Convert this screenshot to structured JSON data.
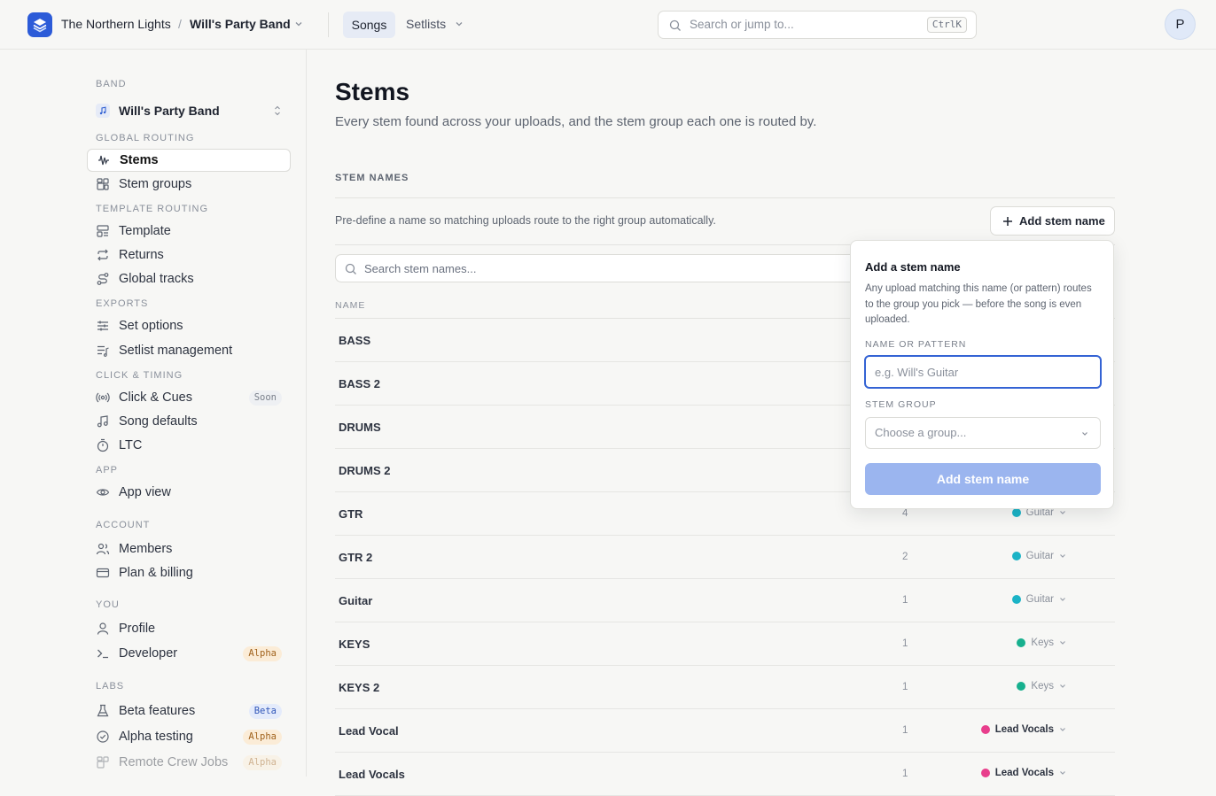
{
  "header": {
    "org_name": "The Northern Lights",
    "separator": "/",
    "band_name": "Will's Party Band",
    "tabs": [
      {
        "label": "Songs"
      },
      {
        "label": "Setlists"
      }
    ],
    "search_placeholder": "Search or jump to...",
    "search_shortcut": "CtrlK",
    "avatar_initial": "P"
  },
  "sidebar": {
    "band_section": "BAND",
    "band_selected": "Will's Party Band",
    "sections": [
      {
        "title": "GLOBAL ROUTING",
        "items": [
          {
            "label": "Stems",
            "icon": "waveform-icon"
          },
          {
            "label": "Stem groups",
            "icon": "grid-icon"
          }
        ]
      },
      {
        "title": "TEMPLATE ROUTING",
        "items": [
          {
            "label": "Template",
            "icon": "layout-icon"
          },
          {
            "label": "Returns",
            "icon": "repeat-icon"
          },
          {
            "label": "Global tracks",
            "icon": "route-icon"
          }
        ]
      },
      {
        "title": "EXPORTS",
        "items": [
          {
            "label": "Set options",
            "icon": "sliders-icon"
          },
          {
            "label": "Setlist management",
            "icon": "list-music-icon"
          }
        ]
      },
      {
        "title": "CLICK & TIMING",
        "items": [
          {
            "label": "Click & Cues",
            "icon": "radio-icon",
            "badge": "Soon"
          },
          {
            "label": "Song defaults",
            "icon": "music-icon"
          },
          {
            "label": "LTC",
            "icon": "timer-icon"
          }
        ]
      },
      {
        "title": "APP",
        "items": [
          {
            "label": "App view",
            "icon": "eye-icon"
          }
        ]
      },
      {
        "title": "ACCOUNT",
        "items": [
          {
            "label": "Members",
            "icon": "users-icon"
          },
          {
            "label": "Plan & billing",
            "icon": "card-icon"
          }
        ]
      },
      {
        "title": "YOU",
        "items": [
          {
            "label": "Profile",
            "icon": "user-icon"
          },
          {
            "label": "Developer",
            "icon": "terminal-icon",
            "badge": "Alpha"
          }
        ]
      },
      {
        "title": "LABS",
        "items": [
          {
            "label": "Beta features",
            "icon": "flask-icon",
            "badge": "Beta"
          },
          {
            "label": "Alpha testing",
            "icon": "check-circle-icon",
            "badge": "Alpha"
          },
          {
            "label": "Remote Crew Jobs",
            "icon": "grid-icon",
            "badge": "Alpha"
          }
        ]
      }
    ]
  },
  "main": {
    "title": "Stems",
    "subtitle": "Every stem found across your uploads, and the stem group each one is routed by.",
    "section_title": "STEM NAMES",
    "section_desc": "Pre-define a name so matching uploads route to the right group automatically.",
    "add_button": "Add stem name",
    "search_placeholder": "Search stem names...",
    "column_name": "NAME",
    "rows": [
      {
        "name": "BASS",
        "count": "",
        "group": "",
        "color": ""
      },
      {
        "name": "BASS 2",
        "count": "",
        "group": "",
        "color": ""
      },
      {
        "name": "DRUMS",
        "count": "",
        "group": "",
        "color": ""
      },
      {
        "name": "DRUMS 2",
        "count": "",
        "group": "",
        "color": ""
      },
      {
        "name": "GTR",
        "count": "4",
        "group": "Guitar",
        "color": "#1bb3c6"
      },
      {
        "name": "GTR 2",
        "count": "2",
        "group": "Guitar",
        "color": "#1bb3c6"
      },
      {
        "name": "Guitar",
        "count": "1",
        "group": "Guitar",
        "color": "#1bb3c6"
      },
      {
        "name": "KEYS",
        "count": "1",
        "group": "Keys",
        "color": "#17b08e"
      },
      {
        "name": "KEYS 2",
        "count": "1",
        "group": "Keys",
        "color": "#17b08e"
      },
      {
        "name": "Lead Vocal",
        "count": "1",
        "group": "Lead Vocals",
        "color": "#e83e8c"
      },
      {
        "name": "Lead Vocals",
        "count": "1",
        "group": "Lead Vocals",
        "color": "#e83e8c"
      }
    ]
  },
  "popover": {
    "title": "Add a stem name",
    "description": "Any upload matching this name (or pattern) routes to the group you pick — before the song is even uploaded.",
    "name_label": "NAME OR PATTERN",
    "name_placeholder": "e.g. Will's Guitar",
    "group_label": "STEM GROUP",
    "group_placeholder": "Choose a group...",
    "submit_label": "Add stem name"
  }
}
